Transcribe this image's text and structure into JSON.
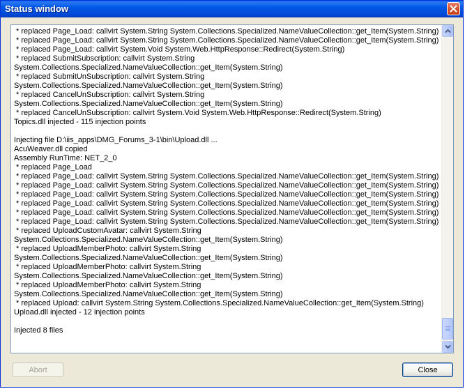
{
  "window": {
    "title": "Status window"
  },
  "log": {
    "lines": [
      " * replaced Page_Load: callvirt System.String System.Collections.Specialized.NameValueCollection::get_Item(System.String)",
      " * replaced Page_Load: callvirt System.String System.Collections.Specialized.NameValueCollection::get_Item(System.String)",
      " * replaced Page_Load: callvirt System.Void System.Web.HttpResponse::Redirect(System.String)",
      " * replaced SubmitSubscription: callvirt System.String",
      "System.Collections.Specialized.NameValueCollection::get_Item(System.String)",
      " * replaced SubmitUnSubscription: callvirt System.String",
      "System.Collections.Specialized.NameValueCollection::get_Item(System.String)",
      " * replaced CancelUnSubscription: callvirt System.String",
      "System.Collections.Specialized.NameValueCollection::get_Item(System.String)",
      " * replaced CancelUnSubscription: callvirt System.Void System.Web.HttpResponse::Redirect(System.String)",
      "Topics.dll injected - 115 injection points",
      "",
      "Injecting file D:\\iis_apps\\DMG_Forums_3-1\\bin\\Upload.dll ...",
      "AcuWeaver.dll copied",
      "Assembly RunTime: NET_2_0",
      " * replaced Page_Load",
      " * replaced Page_Load: callvirt System.String System.Collections.Specialized.NameValueCollection::get_Item(System.String)",
      " * replaced Page_Load: callvirt System.String System.Collections.Specialized.NameValueCollection::get_Item(System.String)",
      " * replaced Page_Load: callvirt System.String System.Collections.Specialized.NameValueCollection::get_Item(System.String)",
      " * replaced Page_Load: callvirt System.String System.Collections.Specialized.NameValueCollection::get_Item(System.String)",
      " * replaced Page_Load: callvirt System.String System.Collections.Specialized.NameValueCollection::get_Item(System.String)",
      " * replaced Page_Load: callvirt System.String System.Collections.Specialized.NameValueCollection::get_Item(System.String)",
      " * replaced UploadCustomAvatar: callvirt System.String",
      "System.Collections.Specialized.NameValueCollection::get_Item(System.String)",
      " * replaced UploadMemberPhoto: callvirt System.String",
      "System.Collections.Specialized.NameValueCollection::get_Item(System.String)",
      " * replaced UploadMemberPhoto: callvirt System.String",
      "System.Collections.Specialized.NameValueCollection::get_Item(System.String)",
      " * replaced UploadMemberPhoto: callvirt System.String",
      "System.Collections.Specialized.NameValueCollection::get_Item(System.String)",
      " * replaced Upload: callvirt System.String System.Collections.Specialized.NameValueCollection::get_Item(System.String)",
      "Upload.dll injected - 12 injection points",
      "",
      "Injected 8 files"
    ]
  },
  "buttons": {
    "abort_label": "Abort",
    "close_label": "Close"
  },
  "colors": {
    "titlebar": "#0058e6",
    "window_bg": "#ece9d8",
    "close_button": "#d6532f"
  }
}
